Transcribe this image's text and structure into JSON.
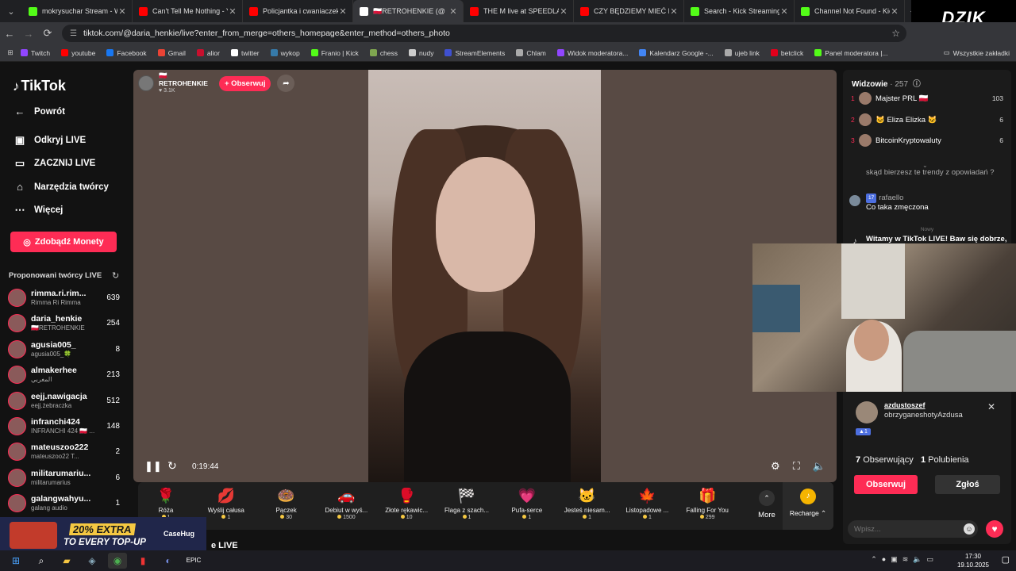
{
  "browser": {
    "tabs": [
      {
        "title": "mokrysuchar Stream - Wa",
        "icon_color": "#53fc18"
      },
      {
        "title": "Can't Tell Me Nothing - Y",
        "icon_color": "#ff0000"
      },
      {
        "title": "Policjantka i cwaniaczek -",
        "icon_color": "#ff0000"
      },
      {
        "title": "🇵🇱RETROHENKIE (@",
        "icon_color": "#ffffff",
        "active": true
      },
      {
        "title": "THE M live at SPEEDLAND",
        "icon_color": "#ff0000"
      },
      {
        "title": "CZY BĘDZIEMY MIEĆ DZIE",
        "icon_color": "#ff0000"
      },
      {
        "title": "Search - Kick Streaming",
        "icon_color": "#53fc18"
      },
      {
        "title": "Channel Not Found - Kick",
        "icon_color": "#53fc18"
      }
    ],
    "logo_text": "DZIK",
    "url": "tiktok.com/@daria_henkie/live?enter_from_merge=others_homepage&enter_method=others_photo",
    "bookmarks": [
      {
        "label": "Twitch",
        "color": "#9146ff"
      },
      {
        "label": "youtube",
        "color": "#ff0000"
      },
      {
        "label": "Facebook",
        "color": "#1877f2"
      },
      {
        "label": "Gmail",
        "color": "#ea4335"
      },
      {
        "label": "alior",
        "color": "#c8102e"
      },
      {
        "label": "twitter",
        "color": "#ffffff"
      },
      {
        "label": "wykop",
        "color": "#367aa9"
      },
      {
        "label": "Franio | Kick",
        "color": "#53fc18"
      },
      {
        "label": "chess",
        "color": "#7fa650"
      },
      {
        "label": "nudy",
        "color": "#cccccc"
      },
      {
        "label": "StreamElements",
        "color": "#3f50d0"
      },
      {
        "label": "Chlam",
        "color": "#aaaaaa"
      },
      {
        "label": "Widok moderatora...",
        "color": "#9146ff"
      },
      {
        "label": "Kalendarz Google -...",
        "color": "#4285f4"
      },
      {
        "label": "ujeb link",
        "color": "#aaaaaa"
      },
      {
        "label": "betclick",
        "color": "#e3001b"
      },
      {
        "label": "Panel moderatora |...",
        "color": "#53fc18"
      }
    ],
    "all_bookmarks": "Wszystkie zakładki"
  },
  "tiktok": {
    "logo": "TikTok",
    "nav": [
      {
        "label": "Powrót",
        "icon": "back-arrow-icon",
        "glyph": "←"
      },
      {
        "label": "Odkryj LIVE",
        "icon": "live-calendar-icon",
        "glyph": "▣"
      },
      {
        "label": "ZACZNIJ LIVE",
        "icon": "camera-icon",
        "glyph": "▭"
      },
      {
        "label": "Narzędzia twórcy",
        "icon": "home-icon",
        "glyph": "⌂"
      },
      {
        "label": "Więcej",
        "icon": "more-dots-icon",
        "glyph": "⋯"
      }
    ],
    "coins_button": "Zdobądź Monety",
    "suggested_title": "Proponowani twórcy LIVE",
    "creators": [
      {
        "name": "rimma.ri.rim...",
        "sub": "Rimma Ri Rimma",
        "viewers": "639"
      },
      {
        "name": "daria_henkie",
        "sub": "🇵🇱RETROHENKIE",
        "viewers": "254"
      },
      {
        "name": "agusia005_",
        "sub": "agusia005_🍀",
        "viewers": "8"
      },
      {
        "name": "almakerhee",
        "sub": "المغربي",
        "viewers": "213"
      },
      {
        "name": "eejj.nawigacja",
        "sub": "eejj.żebraczka",
        "viewers": "512"
      },
      {
        "name": "infranchi424",
        "sub": "INFRANCHI 424 🇵🇱 ...",
        "viewers": "148"
      },
      {
        "name": "mateuszoo222",
        "sub": "mateuszoo22 T...",
        "viewers": "2"
      },
      {
        "name": "militarumariu...",
        "sub": "militarumarius",
        "viewers": "6"
      },
      {
        "name": "galangwahyu...",
        "sub": "galang audio",
        "viewers": "1"
      }
    ],
    "host": {
      "name": "🇵🇱RETROHENKIE",
      "likes": "♥ 3.1K",
      "follow": "+ Obserwuj"
    },
    "player": {
      "time": "0:19:44"
    },
    "gifts": [
      {
        "name": "Róża",
        "price": "1",
        "glyph": "🌹"
      },
      {
        "name": "Wyślij całusa",
        "price": "1",
        "glyph": "💋"
      },
      {
        "name": "Pączek",
        "price": "30",
        "glyph": "🍩"
      },
      {
        "name": "Debiut w wyś...",
        "price": "1500",
        "glyph": "🚗"
      },
      {
        "name": "Złote rękawic...",
        "price": "10",
        "glyph": "🥊"
      },
      {
        "name": "Flaga z szach...",
        "price": "1",
        "glyph": "🏁"
      },
      {
        "name": "Pufa-serce",
        "price": "1",
        "glyph": "💗"
      },
      {
        "name": "Jesteś niesam...",
        "price": "1",
        "glyph": "🐱"
      },
      {
        "name": "Listopadowe ...",
        "price": "1",
        "glyph": "🍁"
      },
      {
        "name": "Falling For You",
        "price": "299",
        "glyph": "🎁"
      }
    ],
    "more_label": "More",
    "recharge_label": "Recharge ⌃",
    "ad": {
      "line1": "20% EXTRA",
      "line2": "TO EVERY TOP-UP",
      "brand": "CaseHug"
    },
    "bottom_title": "e LIVE",
    "viewers_title": "Widzowie",
    "viewers_count": "· 257",
    "top_viewers": [
      {
        "rank": "1",
        "name": "Majster PRL 🇵🇱",
        "score": "103"
      },
      {
        "rank": "2",
        "name": "🐱 Eliza Elizka 🐱",
        "score": "6"
      },
      {
        "rank": "3",
        "name": "BitcoinKryptowaluty",
        "score": "6"
      }
    ],
    "chat": [
      {
        "user": "",
        "text": "skąd bierzesz te trendy z opowiadań ?"
      },
      {
        "user": "rafaello",
        "badge": "17",
        "text": "Co taka zmęczona"
      }
    ],
    "new_divider": "Nowy",
    "welcome": "Witamy w TikTok LIVE! Baw się dobrze,",
    "profile": {
      "username": "azdustoszef",
      "display": "obrzyganeshotyAzdusa",
      "level": "1",
      "followers_num": "7",
      "followers_label": "Obserwujący",
      "likes_num": "1",
      "likes_label": "Polubienia",
      "follow_btn": "Obserwuj",
      "report_btn": "Zgłoś"
    },
    "chat_placeholder": "Wpisz..."
  },
  "taskbar": {
    "time": "17:30",
    "date": "19.10.2025"
  }
}
